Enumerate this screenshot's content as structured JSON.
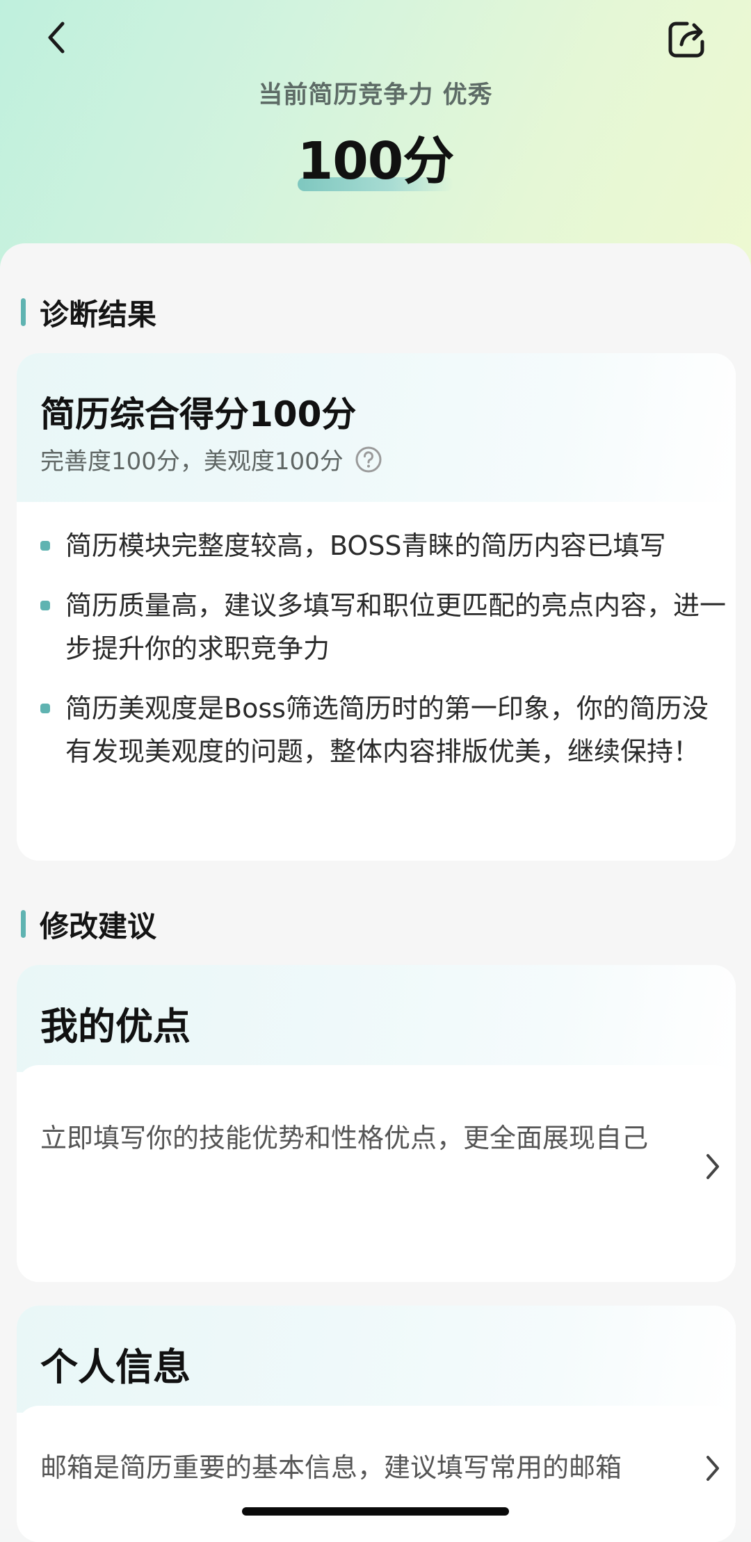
{
  "header": {
    "subtitle": "当前简历竞争力 优秀",
    "score": "100分",
    "back_icon": "chevron-left-icon",
    "share_icon": "share-icon"
  },
  "diagnosis": {
    "section_title": "诊断结果",
    "card_title": "简历综合得分100分",
    "card_subtitle": "完善度100分，美观度100分",
    "help_icon": "question-circle-icon",
    "bullets": [
      "简历模块完整度较高，BOSS青睐的简历内容已填写",
      "简历质量高，建议多填写和职位更匹配的亮点内容，进一步提升你的求职竞争力",
      "简历美观度是Boss筛选简历时的第一印象，你的简历没有发现美观度的问题，整体内容排版优美，继续保持！"
    ]
  },
  "suggestions": {
    "section_title": "修改建议",
    "cards": [
      {
        "title": "我的优点",
        "text": "立即填写你的技能优势和性格优点，更全面展现自己"
      },
      {
        "title": "个人信息",
        "text": "邮箱是简历重要的基本信息，建议填写常用的邮箱"
      }
    ]
  },
  "colors": {
    "accent": "#5fb3b1",
    "hero_start": "#bff0dd",
    "hero_end": "#eef9d1"
  }
}
